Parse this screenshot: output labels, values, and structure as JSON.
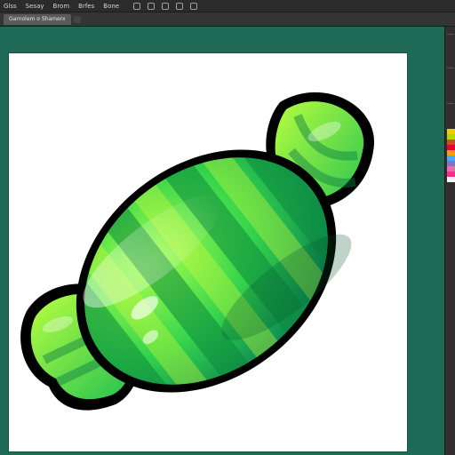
{
  "menu": {
    "items": [
      {
        "id": "menu-1",
        "label": "Glss"
      },
      {
        "id": "menu-2",
        "label": "Sesay"
      },
      {
        "id": "menu-3",
        "label": "Brom"
      },
      {
        "id": "menu-4",
        "label": "Brfes"
      },
      {
        "id": "menu-5",
        "label": "Bone"
      }
    ],
    "icon_names": [
      "window-control-icon",
      "window-control-icon",
      "window-control-icon",
      "window-control-icon",
      "window-control-icon"
    ]
  },
  "document_tab": {
    "title": "Garnolem o Shamerx"
  },
  "colors": {
    "app_background": "#1f6a57",
    "menu_background": "#2b2b2b",
    "options_background": "#343434",
    "panel_background": "#2f2f2f",
    "document_background": "#ffffff"
  },
  "swatches": [
    {
      "name": "swatch-1",
      "color": "#e7d000"
    },
    {
      "name": "swatch-2",
      "color": "#b5d700"
    },
    {
      "name": "swatch-3",
      "color": "#d04a1f"
    },
    {
      "name": "swatch-4",
      "color": "#e7002f"
    },
    {
      "name": "swatch-5",
      "color": "#f4a000"
    },
    {
      "name": "swatch-6",
      "color": "#4ea5ff"
    },
    {
      "name": "swatch-7",
      "color": "#8b6fc7"
    },
    {
      "name": "swatch-8",
      "color": "#f06aa9"
    },
    {
      "name": "swatch-9",
      "color": "#ff2b8e"
    },
    {
      "name": "swatch-10",
      "color": "#f7f7f7"
    }
  ]
}
